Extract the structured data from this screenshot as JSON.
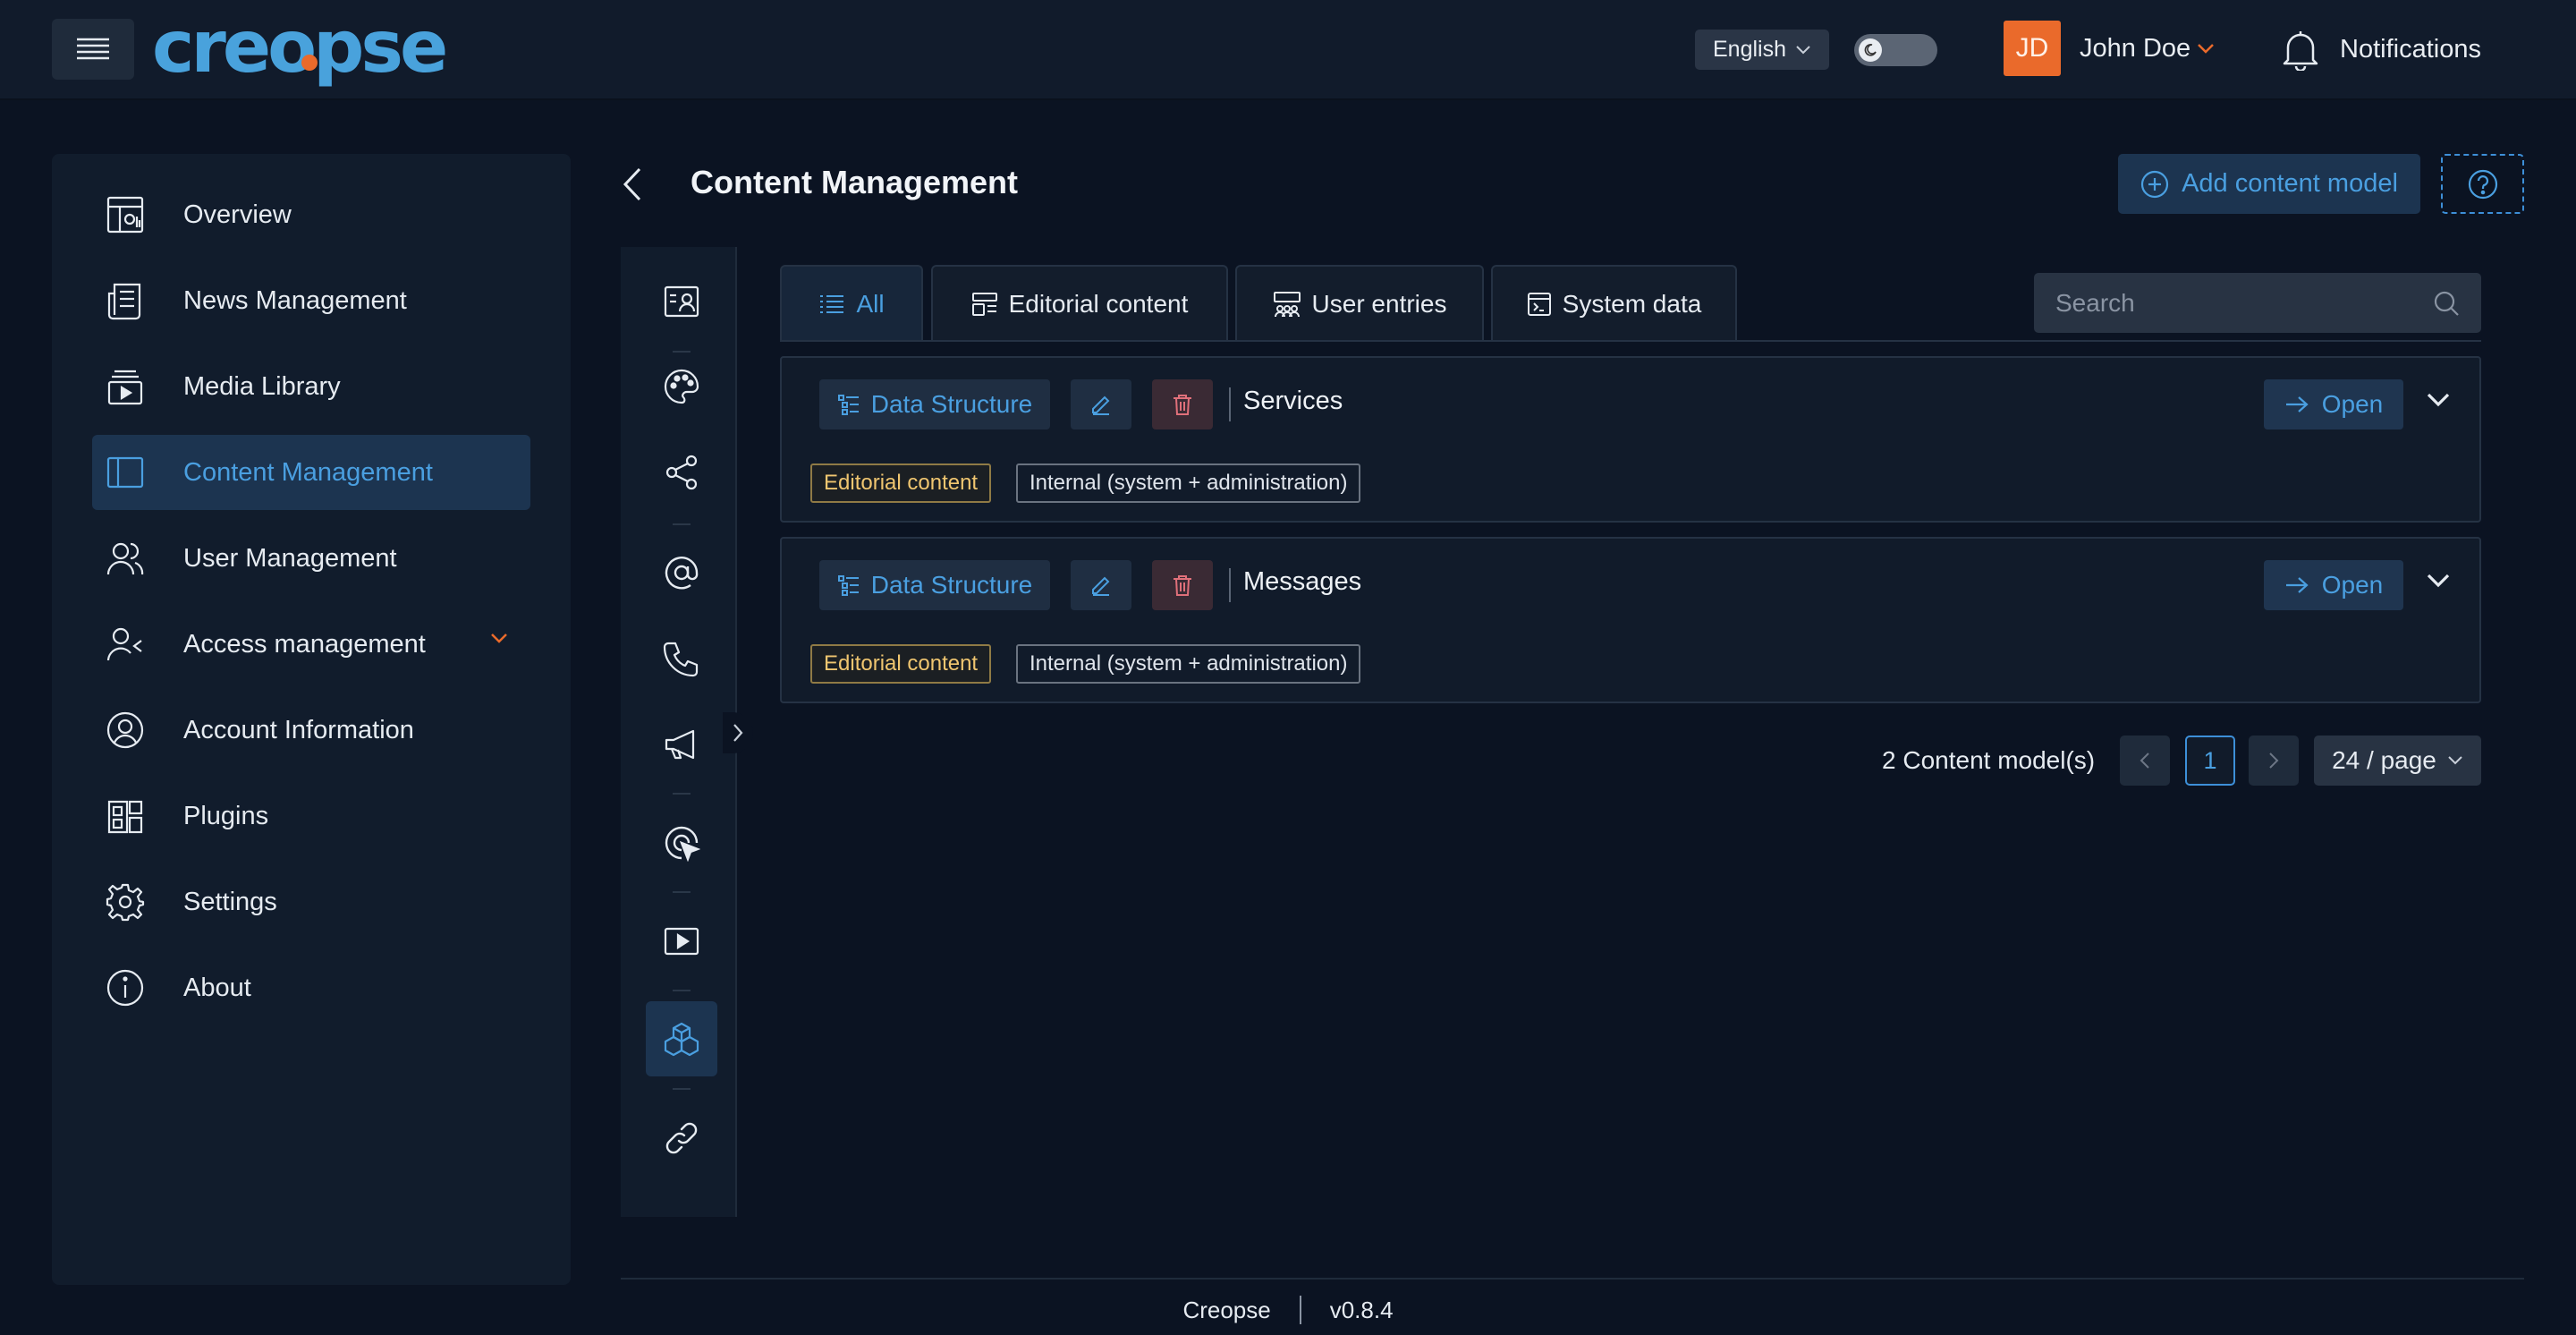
{
  "header": {
    "logo_text": "creopse",
    "language": "English",
    "user_initials": "JD",
    "user_name": "John Doe",
    "notifications_label": "Notifications"
  },
  "sidebar": {
    "items": [
      {
        "label": "Overview",
        "icon": "dashboard-icon"
      },
      {
        "label": "News Management",
        "icon": "news-icon"
      },
      {
        "label": "Media Library",
        "icon": "media-library-icon"
      },
      {
        "label": "Content Management",
        "icon": "layout-sidebar-icon",
        "active": true
      },
      {
        "label": "User Management",
        "icon": "users-icon"
      },
      {
        "label": "Access management",
        "icon": "user-access-icon",
        "expandable": true
      },
      {
        "label": "Account Information",
        "icon": "account-circle-icon"
      },
      {
        "label": "Plugins",
        "icon": "plugins-icon"
      },
      {
        "label": "Settings",
        "icon": "gear-icon"
      },
      {
        "label": "About",
        "icon": "info-icon"
      }
    ]
  },
  "page": {
    "title": "Content Management",
    "add_button_label": "Add content model"
  },
  "rail": {
    "icons": [
      "contact-card-icon",
      "palette-icon",
      "share-icon",
      "at-sign-icon",
      "phone-icon",
      "megaphone-icon",
      "cursor-target-icon",
      "video-play-icon",
      "cubes-icon",
      "link-icon"
    ],
    "active": "cubes-icon"
  },
  "tabs": [
    {
      "label": "All",
      "icon": "list-icon",
      "active": true
    },
    {
      "label": "Editorial content",
      "icon": "editorial-icon"
    },
    {
      "label": "User entries",
      "icon": "user-entries-icon"
    },
    {
      "label": "System data",
      "icon": "system-data-icon"
    }
  ],
  "search": {
    "placeholder": "Search"
  },
  "models": [
    {
      "type_label": "Data Structure",
      "name": "Services",
      "open_label": "Open",
      "tags": [
        "Editorial content",
        "Internal (system + administration)"
      ]
    },
    {
      "type_label": "Data Structure",
      "name": "Messages",
      "open_label": "Open",
      "tags": [
        "Editorial content",
        "Internal (system + administration)"
      ]
    }
  ],
  "pagination": {
    "count_text": "2 Content model(s)",
    "current_page": "1",
    "page_size": "24 / page"
  },
  "footer": {
    "app_name": "Creopse",
    "version": "v0.8.4"
  },
  "colors": {
    "background": "#0b1322",
    "panel": "#111c2c",
    "accent": "#4a9fe0",
    "brand_orange": "#ea6a2b",
    "tag_yellow": "#f0c670"
  }
}
